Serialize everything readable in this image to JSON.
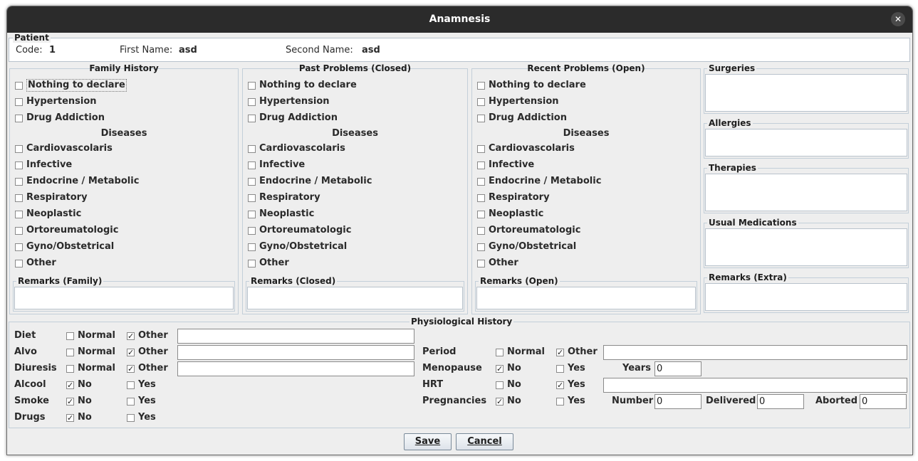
{
  "window": {
    "title": "Anamnesis",
    "close_glyph": "✕"
  },
  "patient": {
    "section_title": "Patient",
    "code_label": "Code:",
    "code_value": "1",
    "first_name_label": "First Name:",
    "first_name_value": "asd",
    "second_name_label": "Second Name:",
    "second_name_value": "asd"
  },
  "history_columns": [
    {
      "title": "Family History",
      "remarks_title": "Remarks (Family)"
    },
    {
      "title": "Past Problems (Closed)",
      "remarks_title": "Remarks (Closed)"
    },
    {
      "title": "Recent Problems (Open)",
      "remarks_title": "Remarks (Open)"
    }
  ],
  "history_common": {
    "items": [
      "Nothing to declare",
      "Hypertension",
      "Drug Addiction"
    ],
    "diseases_label": "Diseases",
    "diseases": [
      "Cardiovascolaris",
      "Infective",
      "Endocrine / Metabolic",
      "Respiratory",
      "Neoplastic",
      "Ortoreumatologic",
      "Gyno/Obstetrical",
      "Other"
    ]
  },
  "side_sections": [
    "Surgeries",
    "Allergies",
    "Therapies",
    "Usual Medications",
    "Remarks (Extra)"
  ],
  "physiological": {
    "title": "Physiological History",
    "diet": {
      "label": "Diet",
      "opt1": "Normal",
      "opt1_checked": false,
      "opt2": "Other",
      "opt2_checked": true,
      "text": ""
    },
    "alvo": {
      "label": "Alvo",
      "opt1": "Normal",
      "opt1_checked": false,
      "opt2": "Other",
      "opt2_checked": true,
      "text": ""
    },
    "diuresis": {
      "label": "Diuresis",
      "opt1": "Normal",
      "opt1_checked": false,
      "opt2": "Other",
      "opt2_checked": true,
      "text": ""
    },
    "alcool": {
      "label": "Alcool",
      "opt1": "No",
      "opt1_checked": true,
      "opt2": "Yes",
      "opt2_checked": false
    },
    "smoke": {
      "label": "Smoke",
      "opt1": "No",
      "opt1_checked": true,
      "opt2": "Yes",
      "opt2_checked": false
    },
    "drugs": {
      "label": "Drugs",
      "opt1": "No",
      "opt1_checked": true,
      "opt2": "Yes",
      "opt2_checked": false
    },
    "period": {
      "label": "Period",
      "opt1": "Normal",
      "opt1_checked": false,
      "opt2": "Other",
      "opt2_checked": true,
      "text": ""
    },
    "menopause": {
      "label": "Menopause",
      "opt1": "No",
      "opt1_checked": true,
      "opt2": "Yes",
      "opt2_checked": false,
      "years_label": "Years",
      "years_value": "0"
    },
    "hrt": {
      "label": "HRT",
      "opt1": "No",
      "opt1_checked": false,
      "opt2": "Yes",
      "opt2_checked": true,
      "text": ""
    },
    "pregnancies": {
      "label": "Pregnancies",
      "opt1": "No",
      "opt1_checked": true,
      "opt2": "Yes",
      "opt2_checked": false,
      "number_label": "Number",
      "number_value": "0",
      "delivered_label": "Delivered",
      "delivered_value": "0",
      "aborted_label": "Aborted",
      "aborted_value": "0"
    }
  },
  "buttons": {
    "save": "Save",
    "cancel": "Cancel"
  },
  "check_glyph": "✓"
}
